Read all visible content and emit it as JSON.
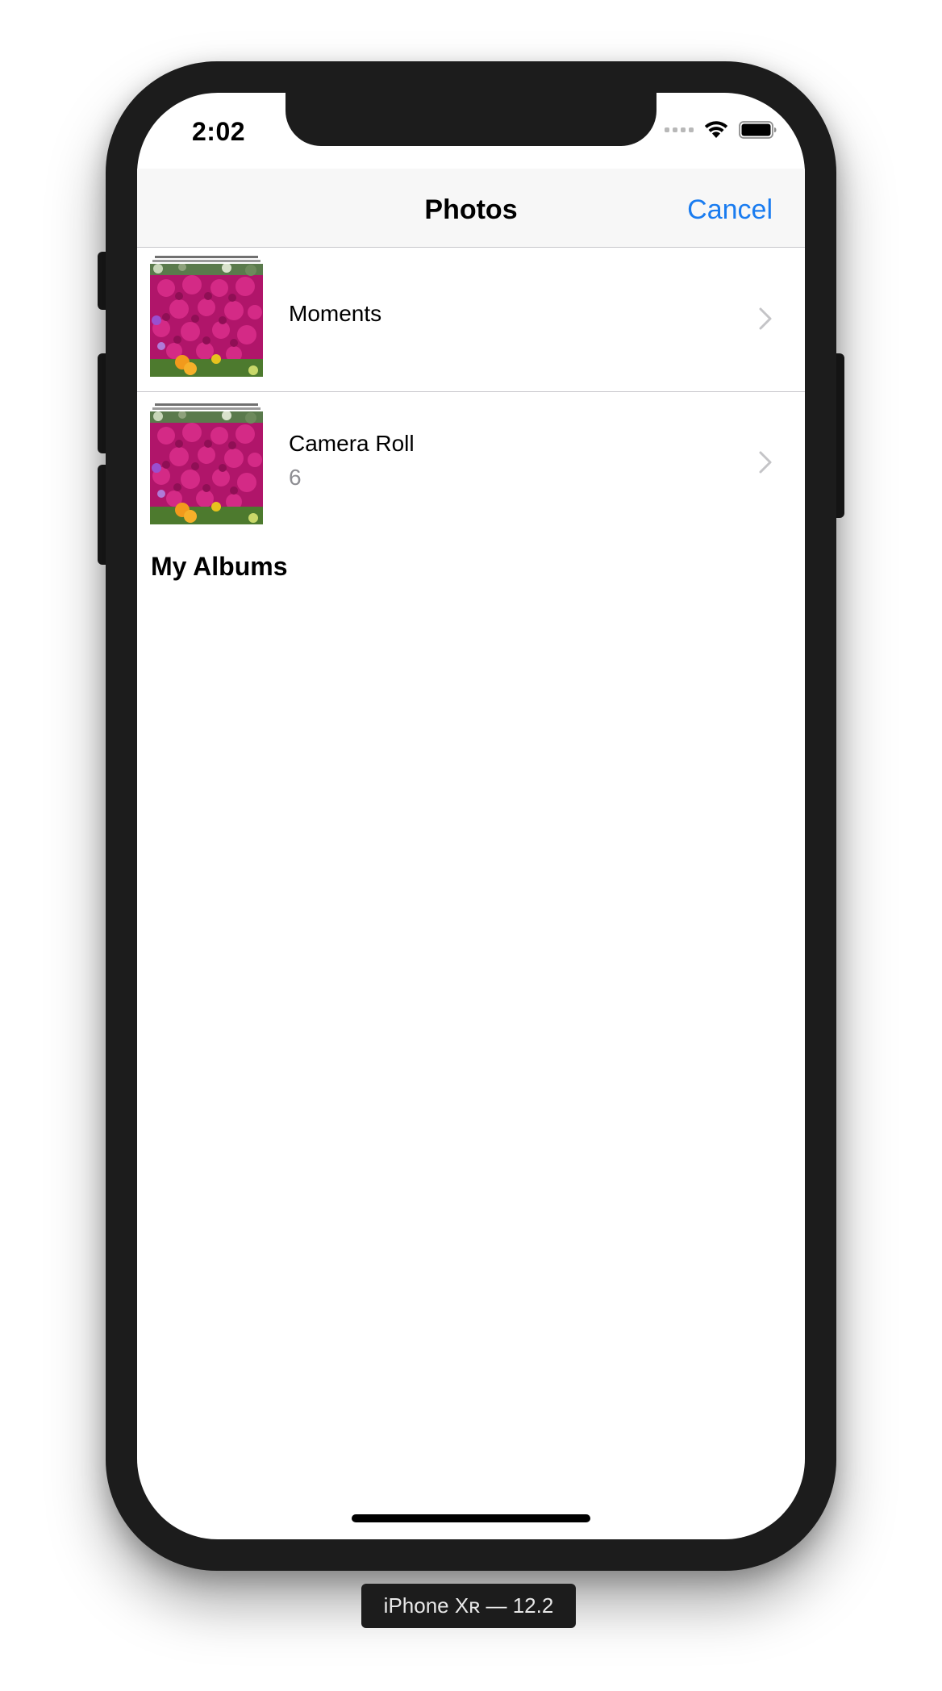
{
  "status_bar": {
    "time": "2:02",
    "icons": [
      "signal-icon",
      "wifi-icon",
      "battery-icon"
    ]
  },
  "navbar": {
    "title": "Photos",
    "cancel_label": "Cancel",
    "accent_color": "#1a7cf0"
  },
  "albums": [
    {
      "title": "Moments",
      "count": "",
      "thumbnail": "flowers-thumbnail",
      "icon": "chevron-right-icon"
    },
    {
      "title": "Camera Roll",
      "count": "6",
      "thumbnail": "flowers-thumbnail",
      "icon": "chevron-right-icon"
    }
  ],
  "sections": {
    "my_albums": "My Albums"
  },
  "device_label": "iPhone Xʀ — 12.2"
}
